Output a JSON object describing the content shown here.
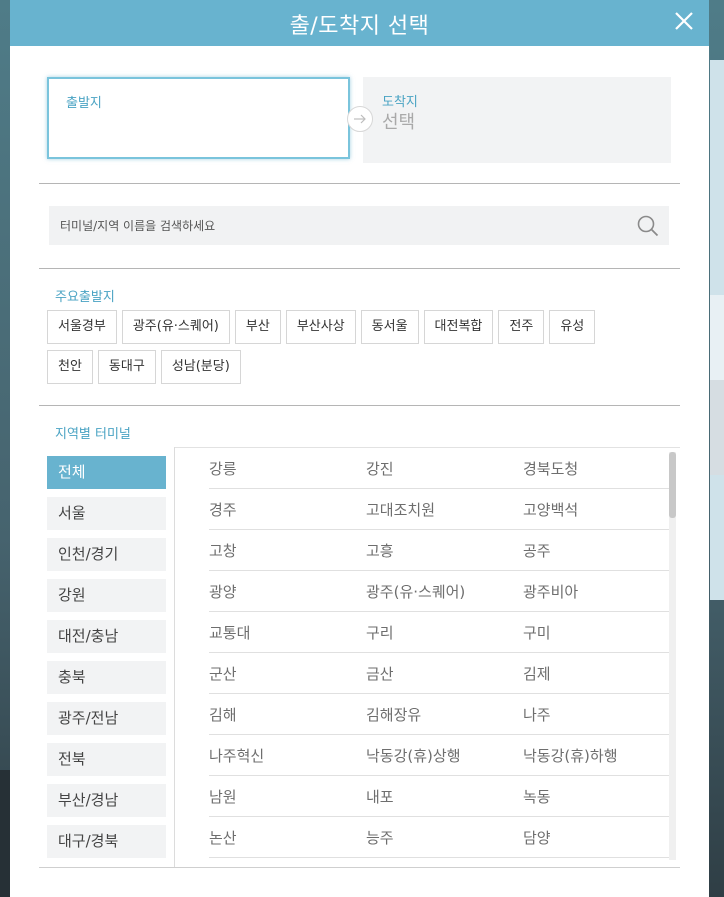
{
  "modal": {
    "title": "출/도착지 선택",
    "header_color": "#68b3cf"
  },
  "departure": {
    "label": "출발지",
    "value": ""
  },
  "arrival": {
    "label": "도착지",
    "value": "선택"
  },
  "search": {
    "placeholder": "터미널/지역 이름을 검색하세요",
    "value": ""
  },
  "main_departures": {
    "label": "주요출발지",
    "chips": [
      "서울경부",
      "광주(유·스퀘어)",
      "부산",
      "부산사상",
      "동서울",
      "대전복합",
      "전주",
      "유성",
      "천안",
      "동대구",
      "성남(분당)"
    ]
  },
  "regions": {
    "label": "지역별 터미널",
    "items": [
      "전체",
      "서울",
      "인천/경기",
      "강원",
      "대전/충남",
      "충북",
      "광주/전남",
      "전북",
      "부산/경남",
      "대구/경북"
    ],
    "active": "전체"
  },
  "terminals": [
    [
      "강릉",
      "강진",
      "경북도청"
    ],
    [
      "경주",
      "고대조치원",
      "고양백석"
    ],
    [
      "고창",
      "고흥",
      "공주"
    ],
    [
      "광양",
      "광주(유·스퀘어)",
      "광주비아"
    ],
    [
      "교통대",
      "구리",
      "구미"
    ],
    [
      "군산",
      "금산",
      "김제"
    ],
    [
      "김해",
      "김해장유",
      "나주"
    ],
    [
      "나주혁신",
      "낙동강(휴)상행",
      "낙동강(휴)하행"
    ],
    [
      "남원",
      "내포",
      "녹동"
    ],
    [
      "논산",
      "능주",
      "담양"
    ]
  ],
  "icons": {
    "close": "close-icon",
    "arrow": "arrow-right-icon",
    "search": "search-icon"
  }
}
